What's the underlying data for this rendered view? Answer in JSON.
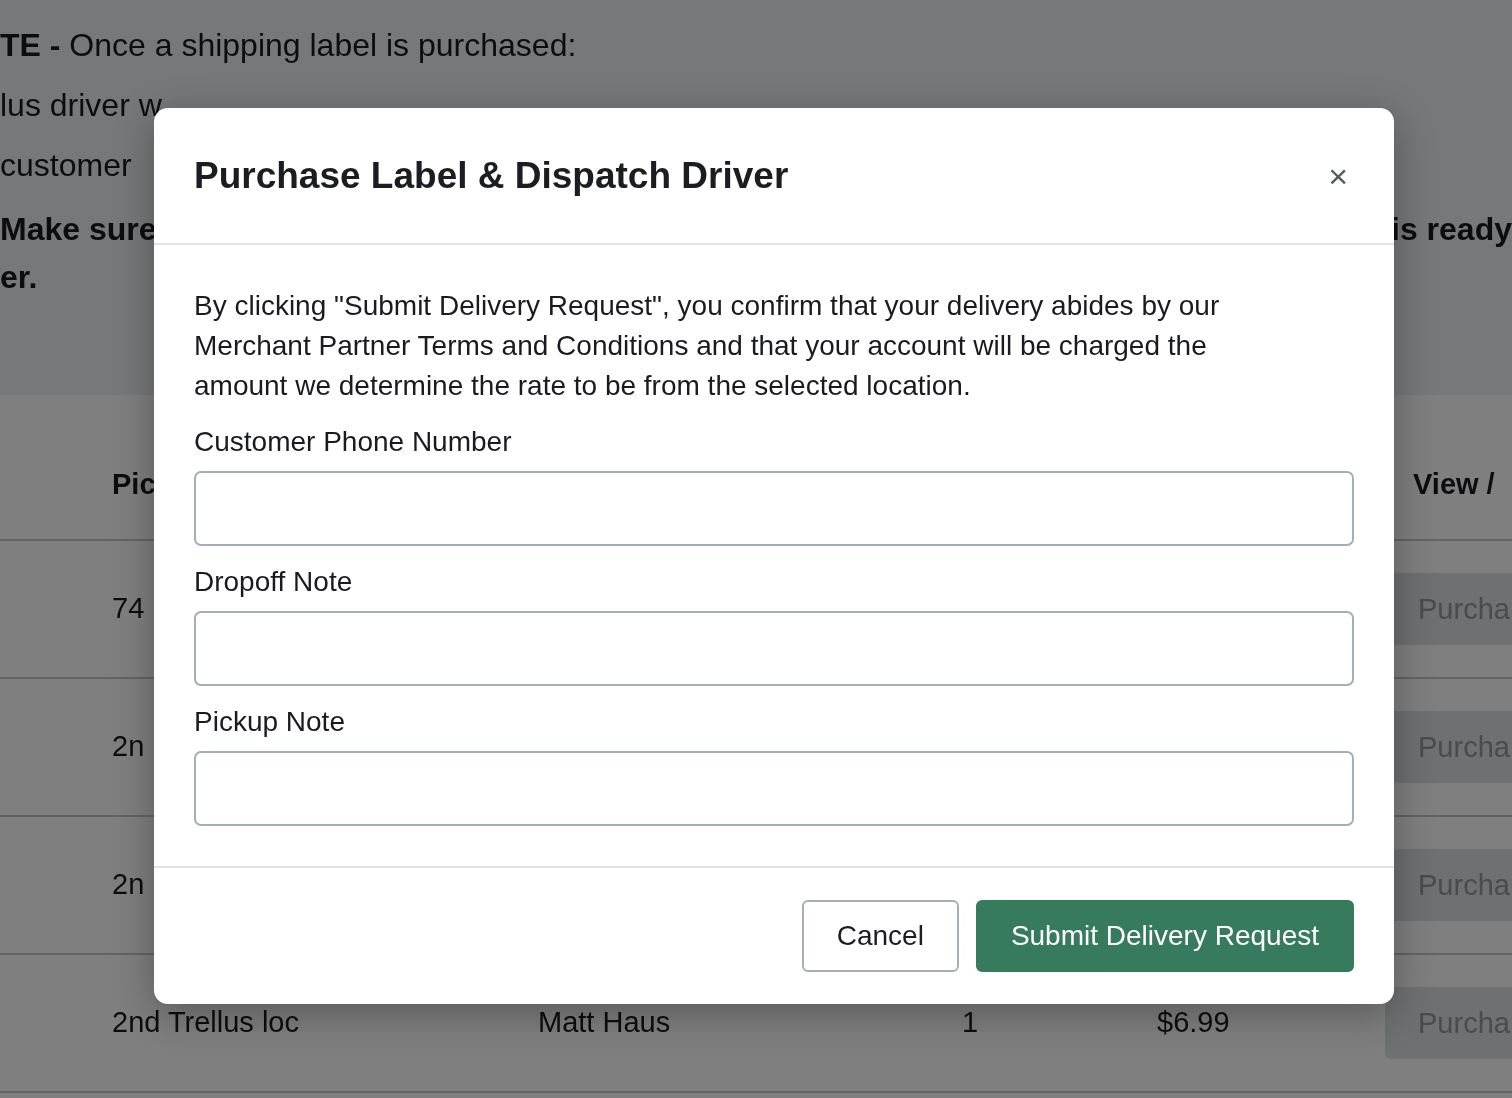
{
  "page": {
    "note": {
      "lines": [
        "**TE -** Once a shipping label is purchased:",
        "lus driver w",
        "customer"
      ],
      "warning": {
        "start": "Make sure",
        "end": "is ready",
        "last": "er."
      }
    },
    "table": {
      "header": {
        "column_2": "Pic",
        "column_6": "View /"
      },
      "rows": [
        {
          "column_2": "74",
          "column_6": "Purcha"
        },
        {
          "column_2": "2n",
          "column_6": "Purcha"
        },
        {
          "column_2": "2n",
          "column_6": "Purcha"
        },
        {
          "column_2": "2nd Trellus loc",
          "column_3": "Matt Haus",
          "column_4": "1",
          "column_5": "$6.99",
          "column_6": "Purcha"
        }
      ]
    }
  },
  "dialog": {
    "title": "Purchase Label & Dispatch Driver",
    "close": "×",
    "message": "By clicking \"Submit Delivery Request\", you confirm that your delivery abides by our Merchant Partner Terms and Conditions and that your account will be charged the amount we determine the rate to be from the selected location.",
    "fields": [
      {
        "label": "Customer Phone Number"
      },
      {
        "label": "Dropoff Note"
      },
      {
        "label": "Pickup Note"
      }
    ],
    "buttons": [
      {
        "label": "Cancel",
        "kind": "secondary"
      },
      {
        "label": "Submit Delivery Request",
        "kind": "primary"
      }
    ]
  }
}
